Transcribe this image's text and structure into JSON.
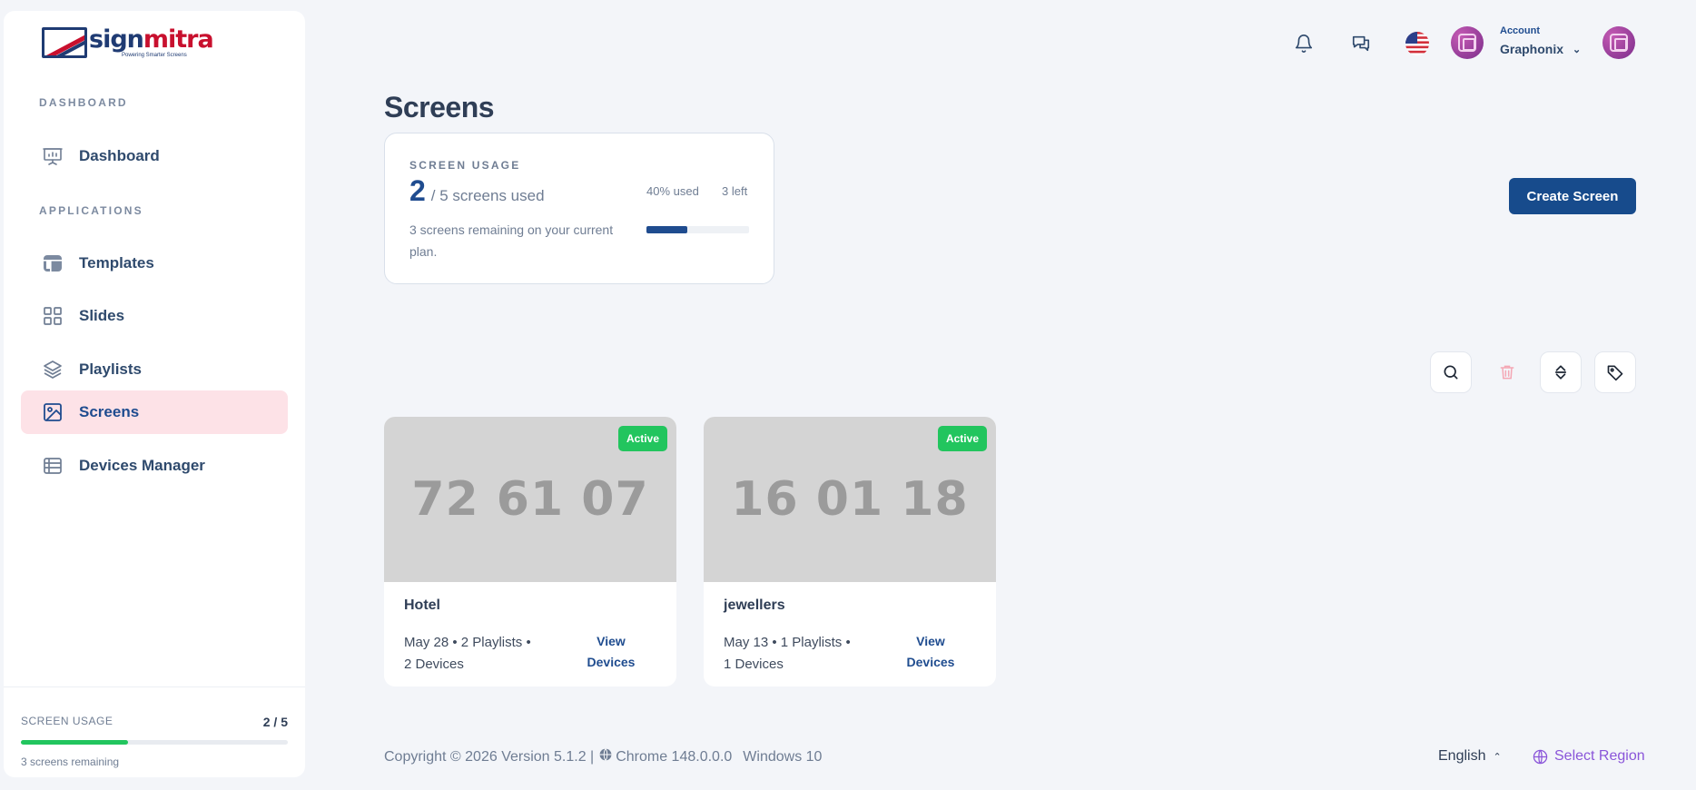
{
  "brand": {
    "name_part1": "sign",
    "name_part2": "mitra",
    "tagline": "Powering Smarter Screens",
    "colors": {
      "primary": "#1f3b73",
      "accent": "#c8102e"
    }
  },
  "sidebar": {
    "section_dashboard": "DASHBOARD",
    "section_applications": "APPLICATIONS",
    "items": [
      {
        "label": "Dashboard",
        "icon": "presentation-board-icon"
      },
      {
        "label": "Templates",
        "icon": "layout-template-icon"
      },
      {
        "label": "Slides",
        "icon": "grid-icon"
      },
      {
        "label": "Playlists",
        "icon": "layers-icon"
      },
      {
        "label": "Screens",
        "icon": "image-icon",
        "active": true
      },
      {
        "label": "Devices Manager",
        "icon": "table-list-icon"
      }
    ],
    "footer": {
      "label": "SCREEN USAGE",
      "count": "2 / 5",
      "used_fraction": 0.4,
      "sub": "3 screens remaining"
    }
  },
  "header": {
    "account_label": "Account",
    "account_name": "Graphonix",
    "icons": [
      "bell-icon",
      "chat-icon",
      "us-flag-icon",
      "avatar",
      "avatar"
    ]
  },
  "main": {
    "title": "Screens",
    "usage": {
      "label": "SCREEN USAGE",
      "used": "2",
      "total": "/ 5 screens used",
      "description": "3 screens remaining on your current plan.",
      "percent_label": "40% used",
      "left_label": "3 left",
      "used_fraction": 0.4
    },
    "create_button": "Create Screen",
    "toolbar": [
      "search-icon",
      "trash-icon",
      "sort-icon",
      "tag-icon"
    ],
    "screens": [
      {
        "code": "72 61 07",
        "status": "Active",
        "name": "Hotel",
        "meta": "May 28 • 2 Playlists • 2 Devices",
        "action": "View Devices"
      },
      {
        "code": "16 01 18",
        "status": "Active",
        "name": "jewellers",
        "meta": "May 13 • 1 Playlists • 1 Devices",
        "action": "View Devices"
      }
    ]
  },
  "footer": {
    "copyright": "Copyright © 2026 Version 5.1.2 |",
    "browser": "Chrome 148.0.0.0",
    "os": "Windows 10",
    "language": "English",
    "region": "Select Region"
  },
  "colors": {
    "active_badge": "#22c55e",
    "primary_button": "#174b8c",
    "active_nav_bg": "#fde2e7",
    "region_link": "#8a55d9"
  }
}
